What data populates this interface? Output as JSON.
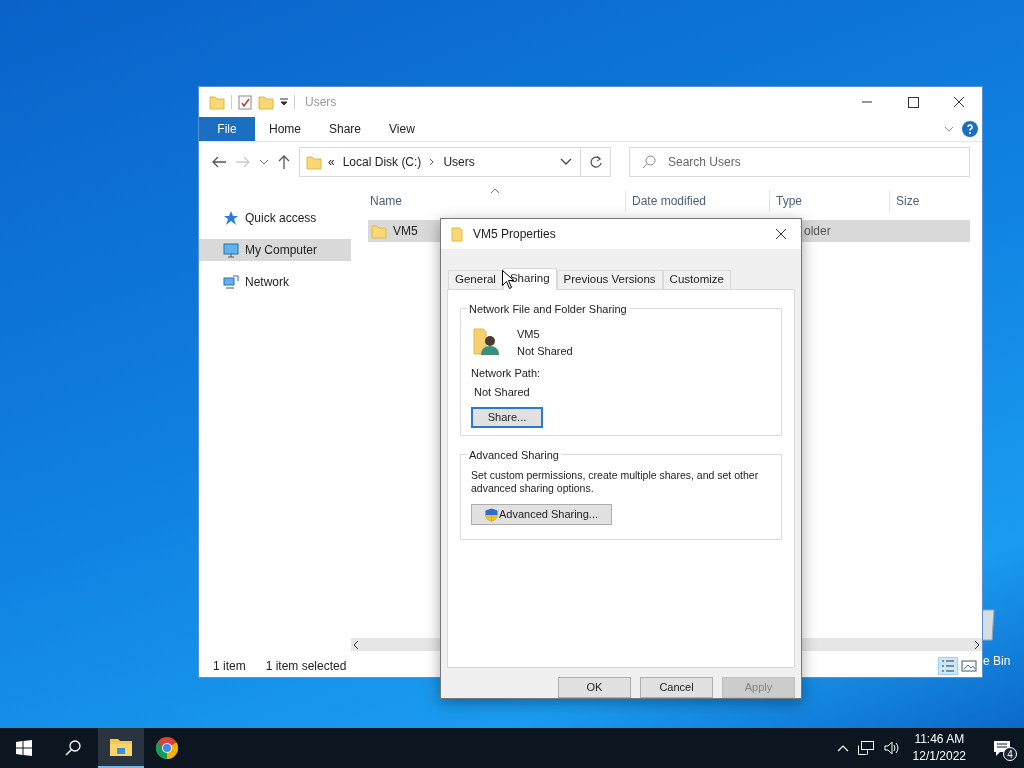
{
  "desktop": {
    "recycle_bin_label": "e Bin"
  },
  "explorer": {
    "title": "Users",
    "ribbon_tabs": [
      {
        "label": "File",
        "kind": "file"
      },
      {
        "label": "Home",
        "kind": "tab"
      },
      {
        "label": "Share",
        "kind": "tab"
      },
      {
        "label": "View",
        "kind": "tab"
      }
    ],
    "address": {
      "prefix": "«",
      "parts": [
        "Local Disk (C:)",
        "Users"
      ]
    },
    "search": {
      "placeholder": "Search Users"
    },
    "sidebar": {
      "items": [
        {
          "label": "Quick access",
          "kind": "star",
          "selected": false
        },
        {
          "label": "My Computer",
          "kind": "computer",
          "selected": true
        },
        {
          "label": "Network",
          "kind": "network",
          "selected": false
        }
      ]
    },
    "columns": [
      "Name",
      "Date modified",
      "Type",
      "Size"
    ],
    "rows": [
      {
        "name": "VM5",
        "type": "older",
        "selected": true
      }
    ],
    "status_bar": {
      "count": "1 item",
      "selection": "1 item selected"
    }
  },
  "dialog": {
    "title": "VM5 Properties",
    "tabs": [
      {
        "label": "General",
        "selected": false
      },
      {
        "label": "Sharing",
        "selected": true
      },
      {
        "label": "Previous Versions",
        "selected": false
      },
      {
        "label": "Customize",
        "selected": false
      }
    ],
    "network_sharing": {
      "title": "Network File and Folder Sharing",
      "name": "VM5",
      "state": "Not Shared",
      "path_label": "Network Path:",
      "path": "Not Shared",
      "button": "Share..."
    },
    "advanced_sharing": {
      "title": "Advanced Sharing",
      "description": "Set custom permissions, create multiple shares, and set other advanced sharing options.",
      "button": "Advanced Sharing..."
    },
    "buttons": [
      {
        "label": "OK",
        "disabled": false
      },
      {
        "label": "Cancel",
        "disabled": false
      },
      {
        "label": "Apply",
        "disabled": true
      }
    ]
  },
  "taskbar": {
    "apps": [
      {
        "kind": "explorer",
        "active": true
      },
      {
        "kind": "chrome",
        "active": false
      }
    ],
    "time": "11:46 AM",
    "date": "12/1/2022",
    "notifications": "4"
  }
}
